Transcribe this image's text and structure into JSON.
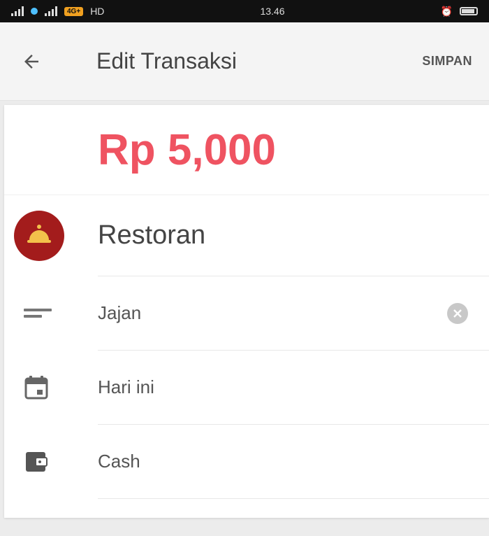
{
  "statusbar": {
    "carrier_badge": "4G+",
    "time": "13.46",
    "signal_label": "HD"
  },
  "toolbar": {
    "title": "Edit Transaksi",
    "save_label": "SIMPAN"
  },
  "transaction": {
    "amount": "Rp 5,000",
    "amount_color": "#ef5361",
    "category": {
      "label": "Restoran",
      "icon": "restaurant-cloche-icon",
      "color": "#a31c1c"
    },
    "note": {
      "value": "Jajan",
      "icon": "note-lines-icon"
    },
    "date": {
      "value": "Hari ini",
      "icon": "calendar-icon"
    },
    "wallet": {
      "value": "Cash",
      "icon": "wallet-icon"
    }
  }
}
